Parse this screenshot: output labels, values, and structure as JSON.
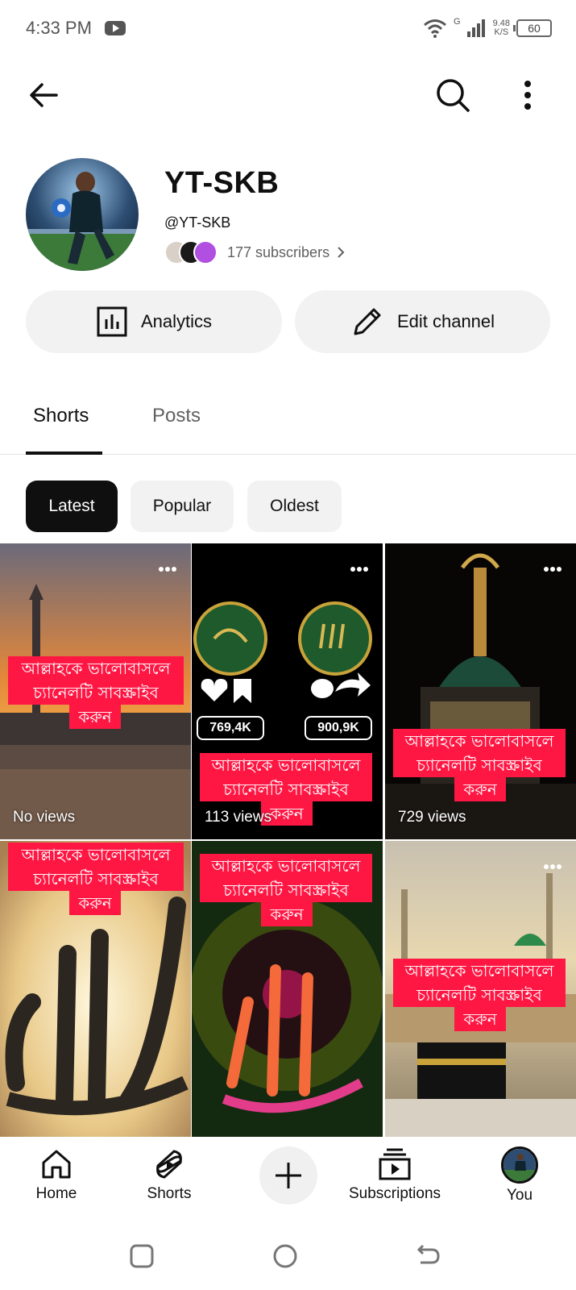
{
  "status_bar": {
    "time": "4:33 PM",
    "network": "G",
    "speed_value": "9.48",
    "speed_unit": "K/S",
    "battery": "60"
  },
  "channel": {
    "name": "YT-SKB",
    "handle": "@YT-SKB",
    "subscribers": "177 subscribers"
  },
  "actions": {
    "analytics_label": "Analytics",
    "edit_label": "Edit channel"
  },
  "tabs": [
    {
      "label": "Shorts",
      "selected": true
    },
    {
      "label": "Posts",
      "selected": false
    }
  ],
  "filters": [
    {
      "label": "Latest",
      "selected": true
    },
    {
      "label": "Popular",
      "selected": false
    },
    {
      "label": "Oldest",
      "selected": false
    }
  ],
  "shorts": [
    {
      "banner": [
        "আল্লাহকে ভালোবাসলে",
        "চ্যানেলটি সাবস্ক্রাইব",
        "করুন"
      ],
      "views": "No views"
    },
    {
      "banner": [
        "আল্লাহকে ভালোবাসলে",
        "চ্যানেলটি সাবস্ক্রাইব",
        "করুন"
      ],
      "views": "113 views",
      "likes": "769,4K",
      "shares": "900,9K"
    },
    {
      "banner": [
        "আল্লাহকে ভালোবাসলে",
        "চ্যানেলটি সাবস্ক্রাইব",
        "করুন"
      ],
      "views": "729 views"
    },
    {
      "banner": [
        "আল্লাহকে ভালোবাসলে",
        "চ্যানেলটি সাবস্ক্রাইব",
        "করুন"
      ],
      "views": ""
    },
    {
      "banner": [
        "আল্লাহকে ভালোবাসলে",
        "চ্যানেলটি সাবস্ক্রাইব",
        "করুন"
      ],
      "views": ""
    },
    {
      "banner": [
        "আল্লাহকে ভালোবাসলে",
        "চ্যানেলটি সাবস্ক্রাইব",
        "করুন"
      ],
      "views": ""
    }
  ],
  "bottom_nav": {
    "home": "Home",
    "shorts": "Shorts",
    "subscriptions": "Subscriptions",
    "you": "You"
  },
  "colors": {
    "banner_red": "#ff1744",
    "chip_selected": "#0f0f0f",
    "pill_bg": "#f2f2f2"
  }
}
